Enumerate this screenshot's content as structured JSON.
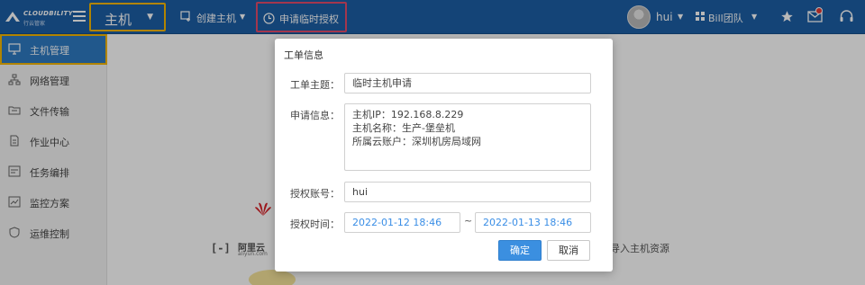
{
  "brand": {
    "name": "CLOUDBILITY",
    "sub": "行云管家"
  },
  "header": {
    "module": "主机",
    "create_host": "创建主机",
    "apply_auth": "申请临时授权",
    "user": "hui",
    "team": "Bill团队"
  },
  "sidebar": {
    "items": [
      {
        "label": "主机管理",
        "icon": "monitor-icon"
      },
      {
        "label": "网络管理",
        "icon": "network-icon"
      },
      {
        "label": "文件传输",
        "icon": "folder-icon"
      },
      {
        "label": "作业中心",
        "icon": "document-icon"
      },
      {
        "label": "任务编排",
        "icon": "task-icon"
      },
      {
        "label": "监控方案",
        "icon": "chart-icon"
      },
      {
        "label": "运维控制",
        "icon": "shield-icon"
      }
    ]
  },
  "background": {
    "aliyun_name": "阿里云",
    "aliyun_domain": "aliyun.com",
    "import_text": "导入主机资源"
  },
  "modal": {
    "title": "工单信息",
    "subject_label": "工单主题：",
    "subject_value": "临时主机申请",
    "info_label": "申请信息：",
    "info_lines": [
      "主机IP：192.168.8.229",
      "主机名称：生产-堡垒机",
      "所属云账户：深圳机房局域网"
    ],
    "account_label": "授权账号：",
    "account_value": "hui",
    "time_label": "授权时间：",
    "time_start": "2022-01-12 18:46",
    "time_sep": "~",
    "time_end": "2022-01-13 18:46",
    "ok_label": "确定",
    "cancel_label": "取消"
  },
  "colors": {
    "header": "#1d5fa6",
    "highlight": "#f5b800",
    "alert_border": "#e44c6b",
    "primary": "#3b8fe0"
  }
}
